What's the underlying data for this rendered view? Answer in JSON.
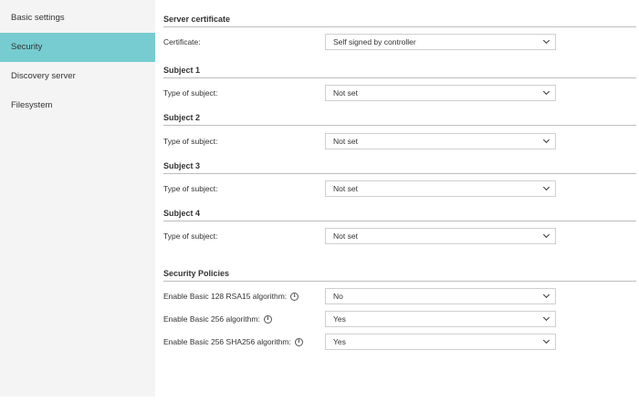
{
  "sidebar": {
    "items": [
      {
        "label": "Basic settings"
      },
      {
        "label": "Security"
      },
      {
        "label": "Discovery server"
      },
      {
        "label": "Filesystem"
      }
    ],
    "active": "Security"
  },
  "server_certificate": {
    "title": "Server certificate",
    "certificate_label": "Certificate:",
    "certificate_value": "Self signed by controller"
  },
  "subjects": [
    {
      "title": "Subject 1",
      "label": "Type of subject:",
      "value": "Not set"
    },
    {
      "title": "Subject 2",
      "label": "Type of subject:",
      "value": "Not set"
    },
    {
      "title": "Subject 3",
      "label": "Type of subject:",
      "value": "Not set"
    },
    {
      "title": "Subject 4",
      "label": "Type of subject:",
      "value": "Not set"
    }
  ],
  "security_policies": {
    "title": "Security Policies",
    "policies": [
      {
        "label": "Enable Basic 128 RSA15 algorithm:",
        "value": "No"
      },
      {
        "label": "Enable Basic 256 algorithm:",
        "value": "Yes"
      },
      {
        "label": "Enable Basic 256 SHA256 algorithm:",
        "value": "Yes"
      }
    ]
  },
  "icons": {
    "info": "info-icon",
    "dropdown": "chevron-down-icon"
  },
  "colors": {
    "sidebar_bg": "#f4f4f4",
    "active_item_bg": "#76ccd0",
    "divider": "#bdbdbd",
    "select_border": "#cfcfcf"
  }
}
